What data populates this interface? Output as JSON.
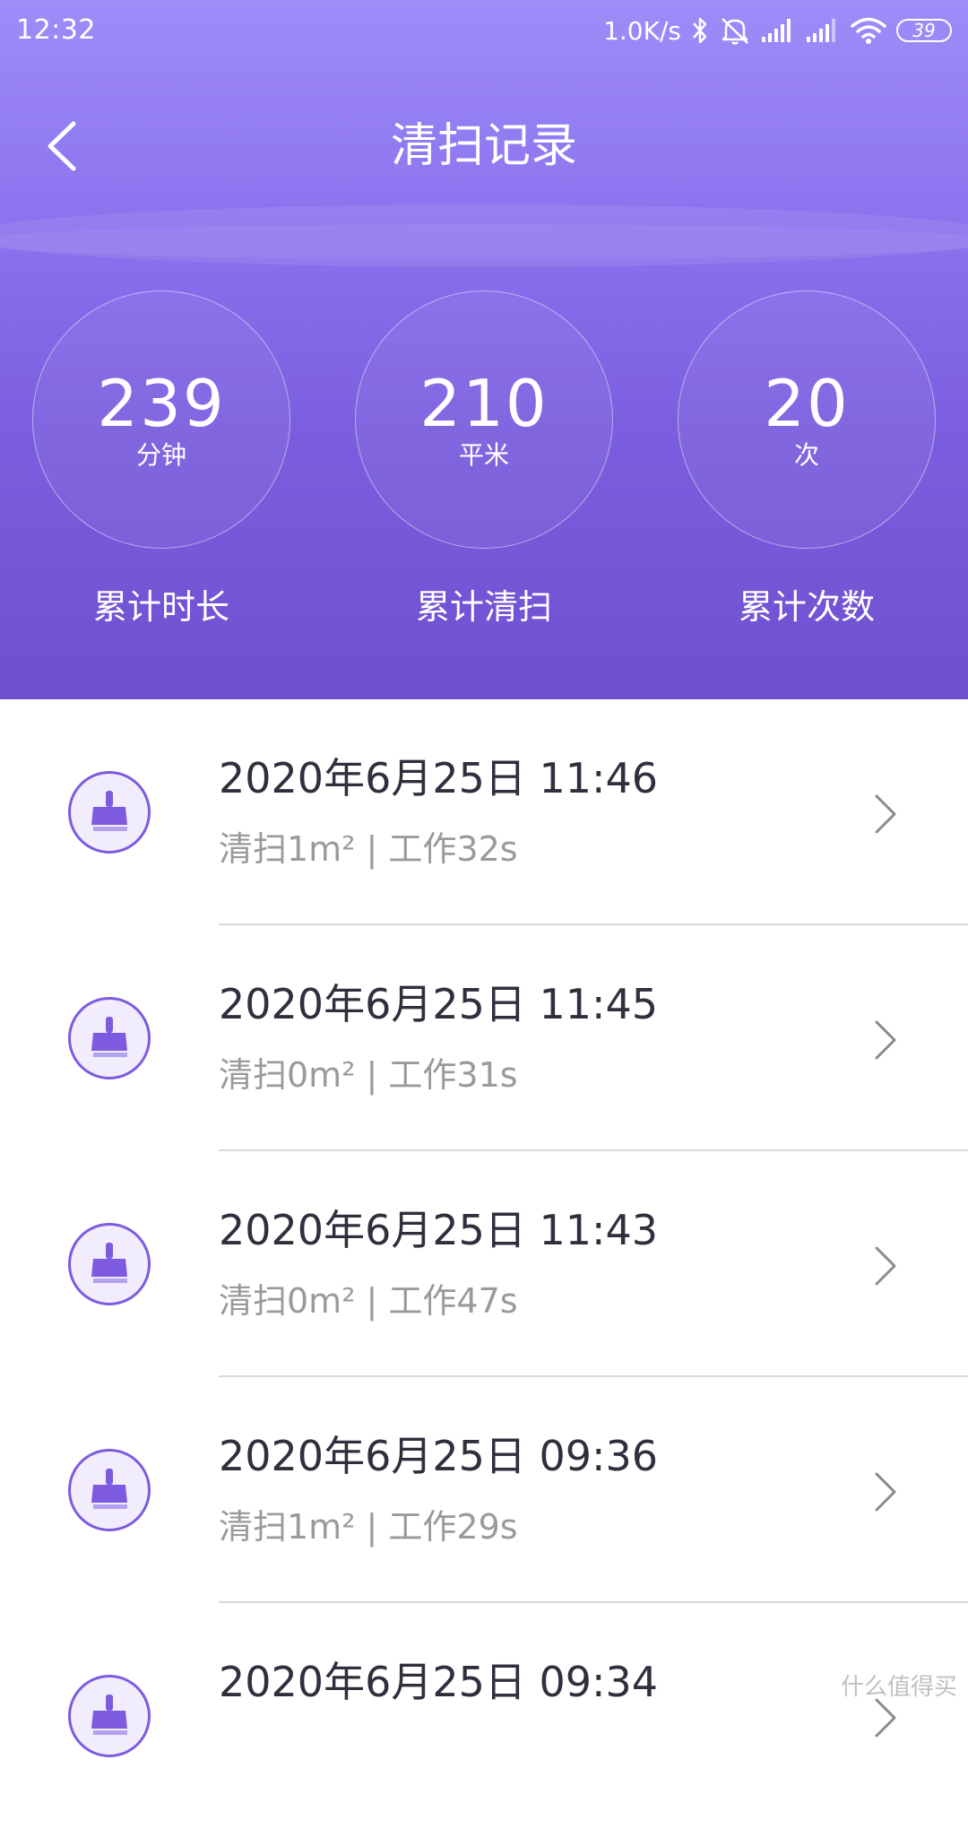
{
  "status": {
    "time": "12:32",
    "net_speed": "1.0K/s",
    "battery": "39",
    "icons": [
      "bluetooth-icon",
      "mute-icon",
      "signal-icon",
      "signal-icon",
      "wifi-icon",
      "battery-icon"
    ]
  },
  "header": {
    "title": "清扫记录",
    "back_icon": "chevron-left-icon"
  },
  "stats": [
    {
      "value": "239",
      "unit": "分钟",
      "label": "累计时长"
    },
    {
      "value": "210",
      "unit": "平米",
      "label": "累计清扫"
    },
    {
      "value": "20",
      "unit": "次",
      "label": "累计次数"
    }
  ],
  "records": [
    {
      "date": "2020年6月25日 11:46",
      "detail": "清扫1m² | 工作32s"
    },
    {
      "date": "2020年6月25日 11:45",
      "detail": "清扫0m² | 工作31s"
    },
    {
      "date": "2020年6月25日 11:43",
      "detail": "清扫0m² | 工作47s"
    },
    {
      "date": "2020年6月25日 09:36",
      "detail": "清扫1m² | 工作29s"
    },
    {
      "date": "2020年6月25日 09:34",
      "detail": ""
    }
  ],
  "watermark": "什么值得买",
  "colors": {
    "accent": "#7d5ae0",
    "header_top": "#9f8cf8",
    "header_bottom": "#6f4fcf"
  }
}
